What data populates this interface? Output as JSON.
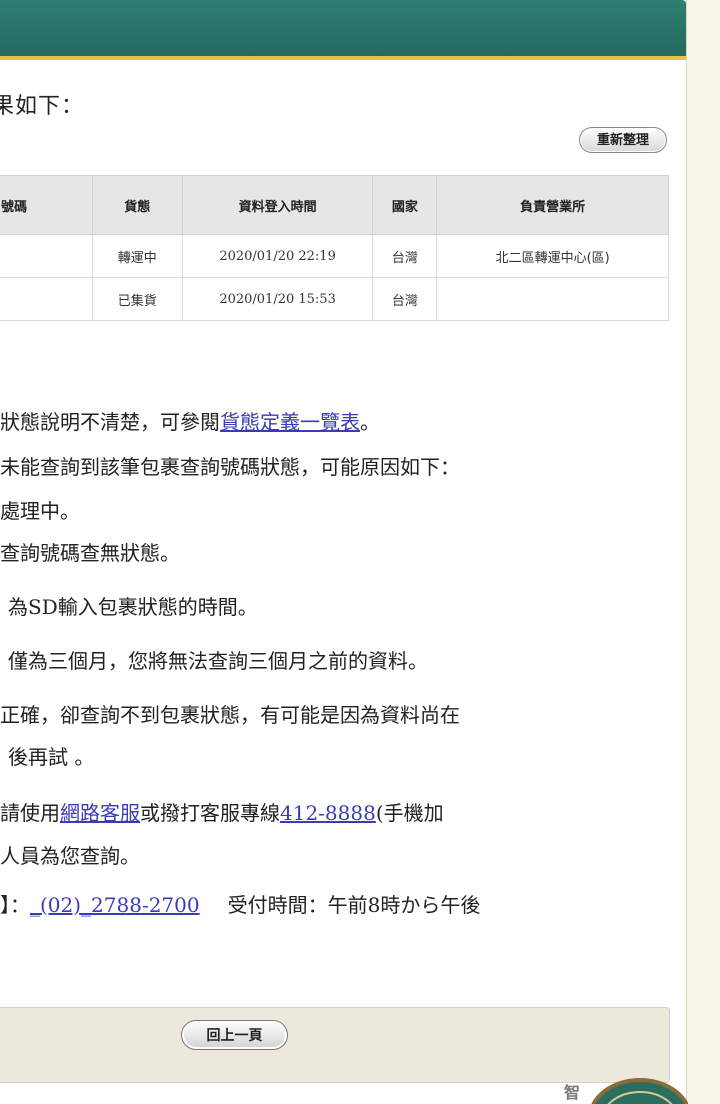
{
  "result": {
    "heading": "果如下："
  },
  "buttons": {
    "refresh": "重新整理",
    "back": "回上一頁"
  },
  "table": {
    "headers": [
      "號碼",
      "貨態",
      "資料登入時間",
      "國家",
      "負責營業所"
    ],
    "rows": [
      [
        "",
        "轉運中",
        "2020/01/20 22:19",
        "台灣",
        "北二區轉運中心(區)"
      ],
      [
        "",
        "已集貨",
        "2020/01/20 15:53",
        "台灣",
        ""
      ]
    ]
  },
  "notes": {
    "line1_pre": "狀態說明不清楚，可參閱",
    "line1_link": "貨態定義一覽表",
    "line1_post": "。",
    "line2": "未能查詢到該筆包裹查詢號碼狀態，可能原因如下：",
    "line3": "處理中。",
    "line4": "查詢號碼查無狀態。",
    "line5": "為SD輸入包裹狀態的時間。",
    "line6": "僅為三個月，您將無法查詢三個月之前的資料。",
    "line7": "正確，卻查詢不到包裹狀態，有可能是因為資料尚在",
    "line8": "後再試 。",
    "line9_pre": "請使用",
    "line9_link1": "網路客服",
    "line9_mid": "或撥打客服專線",
    "line9_link2": "412-8888",
    "line9_post": "(手機加",
    "line10": "人員為您查詢。",
    "line11_pre": "】：",
    "line11_link": "_(02)_2788-2700",
    "line11_post": "受付時間：午前8時から午後"
  },
  "mascot": {
    "label": "智"
  },
  "colors": {
    "header_teal": "#2d7f72",
    "header_accent": "#e6c33d",
    "link": "#3b3bb7"
  }
}
